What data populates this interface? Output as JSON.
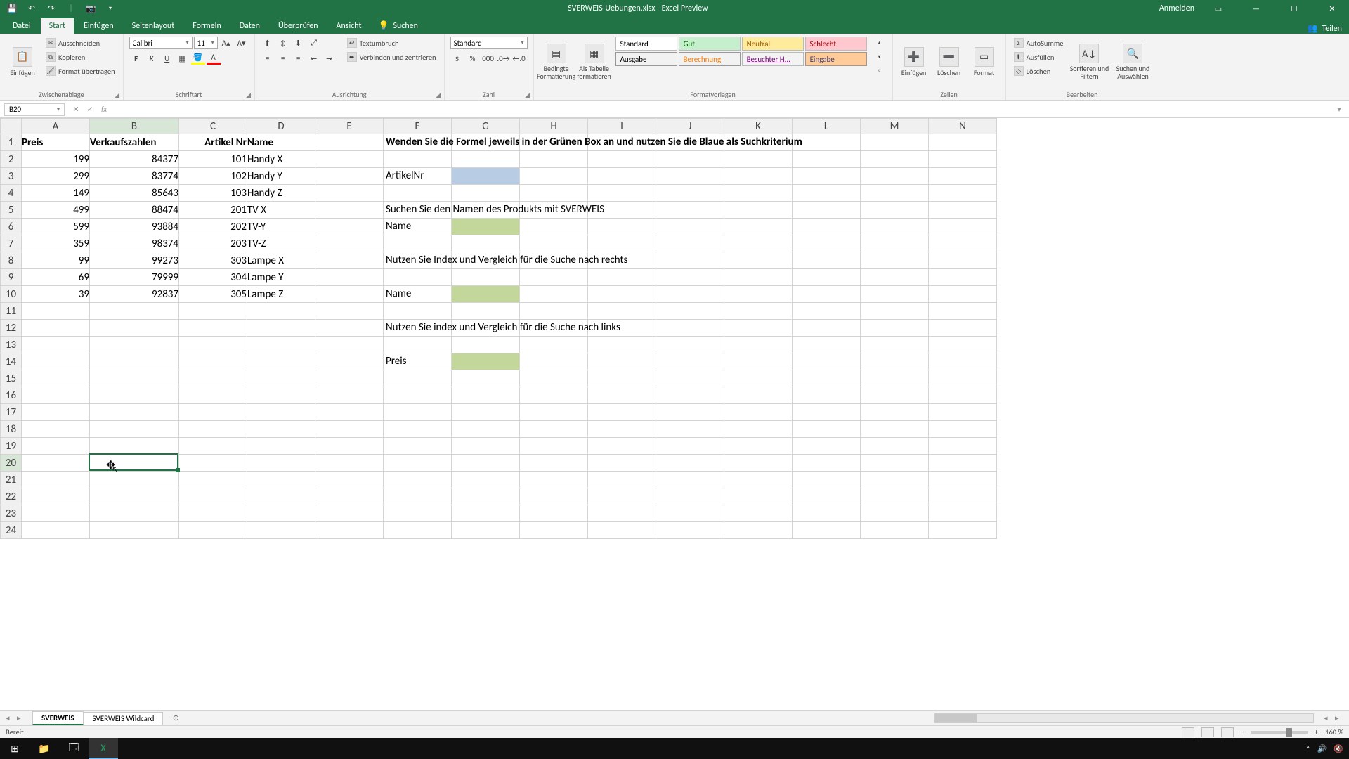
{
  "title": "SVERWEIS-Uebungen.xlsx - Excel Preview",
  "titlebar": {
    "sign_in": "Anmelden"
  },
  "tabs": {
    "file": "Datei",
    "home": "Start",
    "insert": "Einfügen",
    "page_layout": "Seitenlayout",
    "formulas": "Formeln",
    "data": "Daten",
    "review": "Überprüfen",
    "view": "Ansicht",
    "tell_me": "Suchen",
    "share": "Teilen"
  },
  "clipboard": {
    "paste": "Einfügen",
    "cut": "Ausschneiden",
    "copy": "Kopieren",
    "format_painter": "Format übertragen",
    "label": "Zwischenablage"
  },
  "font": {
    "name": "Calibri",
    "size": "11",
    "label": "Schriftart"
  },
  "alignment": {
    "wrap": "Textumbruch",
    "merge": "Verbinden und zentrieren",
    "label": "Ausrichtung"
  },
  "number": {
    "format": "Standard",
    "label": "Zahl"
  },
  "styles": {
    "cond": "Bedingte Formatierung",
    "table": "Als Tabelle formatieren",
    "s1": "Standard",
    "s2": "Gut",
    "s3": "Neutral",
    "s4": "Schlecht",
    "s5": "Ausgabe",
    "s6": "Berechnung",
    "s7": "Besuchter H...",
    "s8": "Eingabe",
    "label": "Formatvorlagen"
  },
  "cells": {
    "insert": "Einfügen",
    "delete": "Löschen",
    "format": "Format",
    "label": "Zellen"
  },
  "editing": {
    "autosum": "AutoSumme",
    "fill": "Ausfüllen",
    "clear": "Löschen",
    "sort": "Sortieren und Filtern",
    "find": "Suchen und Auswählen",
    "label": "Bearbeiten"
  },
  "formula_bar": {
    "cell_ref": "B20",
    "formula": ""
  },
  "columns": [
    "A",
    "B",
    "C",
    "D",
    "E",
    "F",
    "G",
    "H",
    "I",
    "J",
    "K",
    "L",
    "M",
    "N"
  ],
  "col_widths": {
    "row_hdr": 30,
    "A": 97,
    "B": 127,
    "C": 97,
    "D": 97,
    "E": 97,
    "F": 97,
    "G": 97,
    "H": 97,
    "I": 97,
    "J": 97,
    "K": 97,
    "L": 97,
    "M": 97,
    "N": 97
  },
  "headers": {
    "A1": "Preis",
    "B1": "Verkaufszahlen",
    "C1": "Artikel Nr",
    "D1": "Name"
  },
  "instruction_F1": "Wenden Sie die Formel jeweils in der Grünen Box an und nutzen Sie die Blaue als Suchkriterium",
  "labels": {
    "F3": "ArtikelNr",
    "F5": "Suchen Sie den Namen des Produkts mit SVERWEIS",
    "F6": "Name",
    "F8": "Nutzen Sie Index und Vergleich für die Suche nach rechts",
    "F10": "Name",
    "F12": "Nutzen Sie index und Vergleich für die Suche nach links",
    "F14": "Preis"
  },
  "rows": [
    {
      "A": "199",
      "B": "84377",
      "C": "101",
      "D": "Handy X"
    },
    {
      "A": "299",
      "B": "83774",
      "C": "102",
      "D": "Handy Y"
    },
    {
      "A": "149",
      "B": "85643",
      "C": "103",
      "D": "Handy Z"
    },
    {
      "A": "499",
      "B": "88474",
      "C": "201",
      "D": "TV X"
    },
    {
      "A": "599",
      "B": "93884",
      "C": "202",
      "D": "TV-Y"
    },
    {
      "A": "359",
      "B": "98374",
      "C": "203",
      "D": "TV-Z"
    },
    {
      "A": "99",
      "B": "99273",
      "C": "303",
      "D": "Lampe X"
    },
    {
      "A": "69",
      "B": "79999",
      "C": "304",
      "D": "Lampe Y"
    },
    {
      "A": "39",
      "B": "92837",
      "C": "305",
      "D": "Lampe Z"
    }
  ],
  "fill_cells": {
    "G3": "#b8cce4",
    "G6": "#c4d79b",
    "G10": "#c4d79b",
    "G14": "#c4d79b"
  },
  "selected_cell": "B20",
  "sheets": {
    "s1": "SVERWEIS",
    "s2": "SVERWEIS Wildcard"
  },
  "status": {
    "ready": "Bereit",
    "zoom": "160 %"
  },
  "chart_data": null
}
